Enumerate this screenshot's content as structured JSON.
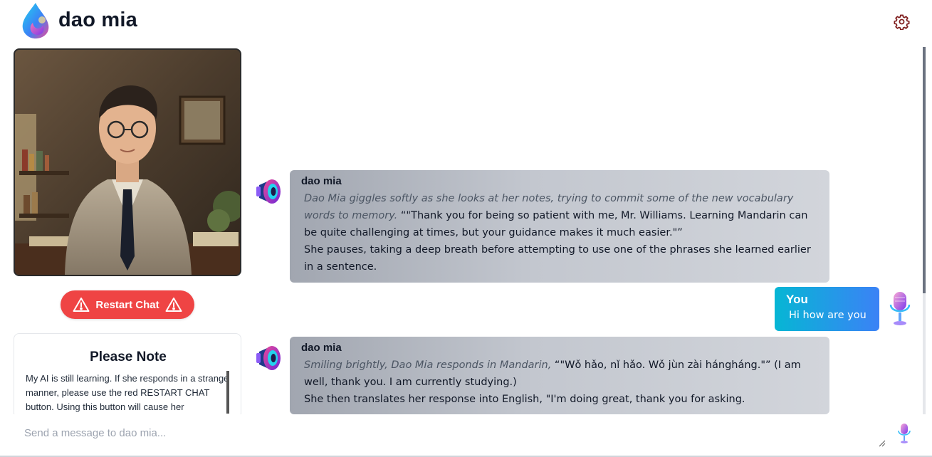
{
  "app": {
    "title": "dao mia",
    "logo_icon": "droplet-logo-icon",
    "settings_icon": "gear-icon",
    "accent_color": "#ef4444",
    "settings_color": "#7f1d1d"
  },
  "sidebar": {
    "portrait_alt": "portrait",
    "restart_button": {
      "label": "Restart Chat",
      "icon": "warning-triangle-icon",
      "color": "#ef4444"
    },
    "note": {
      "title": "Please Note",
      "body": "My AI is still learning. If she responds in a strange manner, please use the red RESTART CHAT button. Using this button will cause her"
    }
  },
  "chat": {
    "messages": [
      {
        "sender": "dao mia",
        "role": "assistant",
        "avatar_icon": "megaphone-icon",
        "action": "Dao Mia giggles softly as she looks at her notes, trying to commit some of the new vocabulary words to memory.",
        "speech": " “\"Thank you for being so patient with me, Mr. Williams. Learning Mandarin can be quite challenging at times, but your guidance makes it much easier.\"”",
        "after": "She pauses, taking a deep breath before attempting to use one of the phrases she learned earlier in a sentence."
      },
      {
        "sender": "You",
        "role": "user",
        "avatar_icon": "microphone-icon",
        "text": "Hi how are you"
      },
      {
        "sender": "dao mia",
        "role": "assistant",
        "avatar_icon": "megaphone-icon",
        "action": "Smiling brightly, Dao Mia responds in Mandarin,",
        "speech": " “\"Wǒ hǎo, nǐ hǎo. Wǒ jùn zài hángháng.\"” (I am well, thank you. I am currently studying.)",
        "after": "She then translates her response into English, \"I'm doing great, thank you for asking."
      }
    ]
  },
  "composer": {
    "placeholder": "Send a message to dao mia...",
    "value": "",
    "mic_icon": "microphone-icon"
  }
}
